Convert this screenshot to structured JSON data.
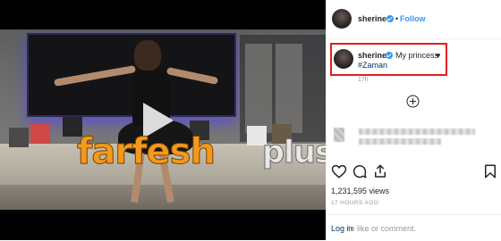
{
  "post": {
    "header": {
      "username": "sherine",
      "separator": "•",
      "follow_label": "Follow"
    },
    "caption": {
      "username": "sherine",
      "text": "My princess",
      "heart": "♥",
      "hashtag": "#Zaman",
      "relative_time": "17h"
    },
    "stats": {
      "views": "1,231,595 views",
      "posted": "17 HOURS AGO"
    },
    "footer": {
      "login_link": "Log in",
      "login_rest": "to like or comment."
    }
  },
  "watermark": {
    "main": "farfesh",
    "sub": "plus.com"
  },
  "colors": {
    "link_blue": "#3897f0",
    "hashtag_blue": "#003569",
    "highlight_red": "#e02020",
    "watermark_orange": "#f39a1e"
  },
  "icons": [
    "play-icon",
    "verified-icon",
    "add-circle-icon",
    "heart-icon",
    "comment-icon",
    "share-icon",
    "bookmark-icon"
  ]
}
